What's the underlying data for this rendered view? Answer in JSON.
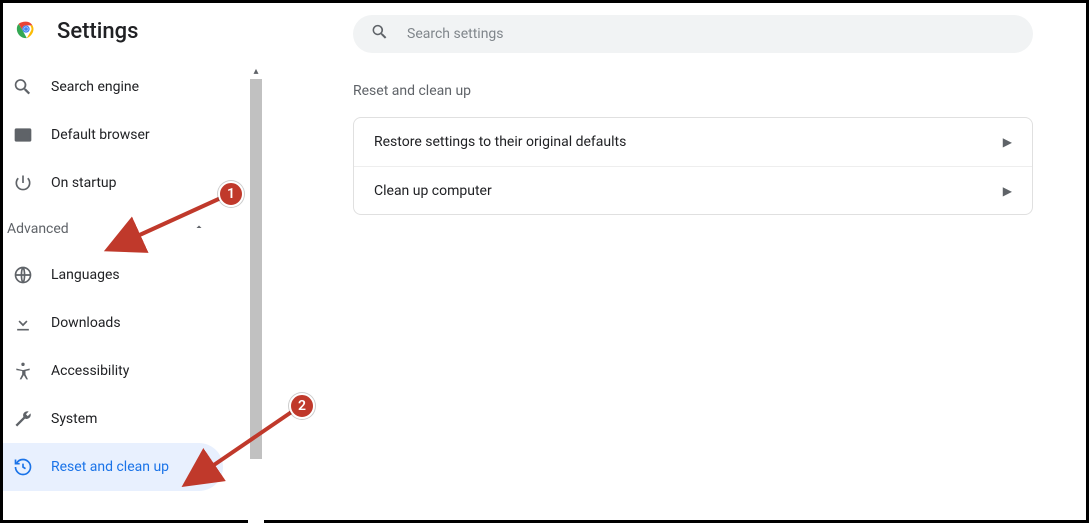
{
  "header": {
    "title": "Settings"
  },
  "search": {
    "placeholder": "Search settings"
  },
  "sidebar": {
    "items": [
      {
        "label": "Search engine"
      },
      {
        "label": "Default browser"
      },
      {
        "label": "On startup"
      }
    ],
    "advanced_label": "Advanced",
    "advanced_items": [
      {
        "label": "Languages"
      },
      {
        "label": "Downloads"
      },
      {
        "label": "Accessibility"
      },
      {
        "label": "System"
      },
      {
        "label": "Reset and clean up"
      }
    ]
  },
  "main": {
    "section_title": "Reset and clean up",
    "rows": [
      {
        "label": "Restore settings to their original defaults"
      },
      {
        "label": "Clean up computer"
      }
    ]
  },
  "annotations": {
    "badge1": "1",
    "badge2": "2"
  }
}
